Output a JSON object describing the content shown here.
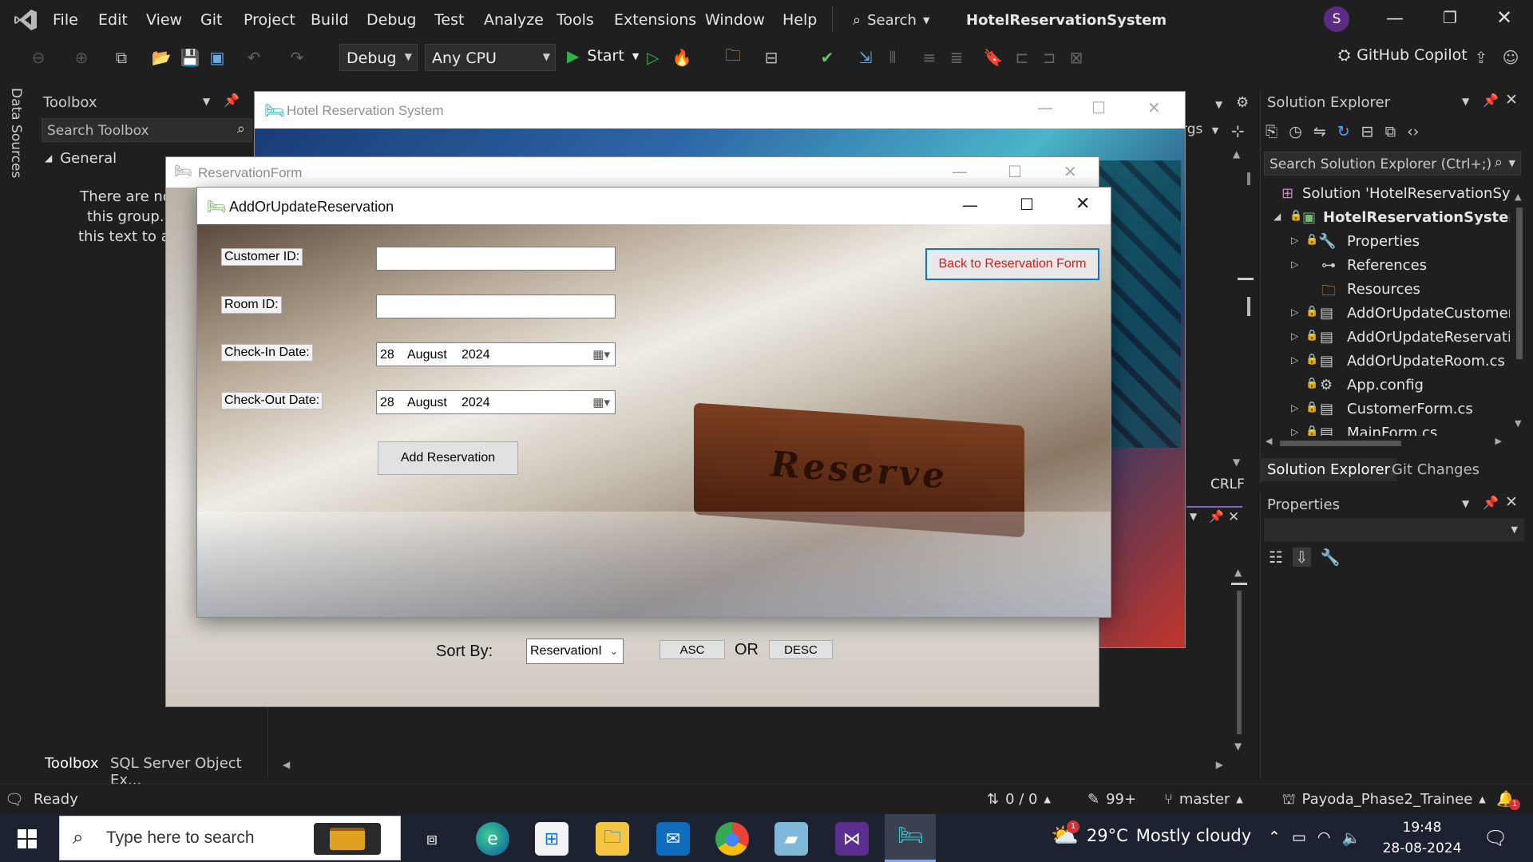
{
  "vs": {
    "menu": [
      "File",
      "Edit",
      "View",
      "Git",
      "Project",
      "Build",
      "Debug",
      "Test",
      "Analyze",
      "Tools",
      "Extensions",
      "Window",
      "Help"
    ],
    "search_label": "Search",
    "solution_title": "HotelReservationSystem",
    "account_initial": "S",
    "config": "Debug",
    "platform": "Any CPU",
    "start_label": "Start",
    "copilot_label": "GitHub Copilot",
    "data_sources": "Data Sources",
    "args_label": "rgs",
    "crlf": "CRLF"
  },
  "toolbox": {
    "title": "Toolbox",
    "search_placeholder": "Search Toolbox",
    "group": "General",
    "empty_line1": "There are no usab",
    "empty_line2": "this group. Drag",
    "empty_line3": "this text to add it t",
    "tab1": "Toolbox",
    "tab2": "SQL Server Object Ex..."
  },
  "solution_explorer": {
    "title": "Solution Explorer",
    "search_placeholder": "Search Solution Explorer (Ctrl+;)",
    "items": [
      {
        "label": "Solution 'HotelReservationSyste"
      },
      {
        "label": "HotelReservationSystem"
      },
      {
        "label": "Properties"
      },
      {
        "label": "References"
      },
      {
        "label": "Resources"
      },
      {
        "label": "AddOrUpdateCustomer.c"
      },
      {
        "label": "AddOrUpdateReservation"
      },
      {
        "label": "AddOrUpdateRoom.cs"
      },
      {
        "label": "App.config"
      },
      {
        "label": "CustomerForm.cs"
      },
      {
        "label": "MainForm.cs"
      }
    ],
    "tab1": "Solution Explorer",
    "tab2": "Git Changes"
  },
  "properties": {
    "title": "Properties"
  },
  "statusbar": {
    "ready": "Ready",
    "arrows": "0 / 0",
    "pencil": "99+",
    "branch": "master",
    "repo": "Payoda_Phase2_Trainee",
    "notifications": "1"
  },
  "taskbar": {
    "search_placeholder": "Type here to search",
    "weather_temp": "29°C",
    "weather_desc": "Mostly cloudy",
    "weather_badge": "1",
    "time": "19:48",
    "date": "28-08-2024"
  },
  "main_window": {
    "title": "Hotel Reservation System"
  },
  "reservation_form": {
    "title": "ReservationForm",
    "sort_by_label": "Sort By:",
    "sort_value": "ReservationI",
    "asc_label": "ASC",
    "or_label": "OR",
    "desc_label": "DESC"
  },
  "add_update_form": {
    "title": "AddOrUpdateReservation",
    "customer_id_label": "Customer ID:",
    "room_id_label": "Room ID:",
    "checkin_label": "Check-In Date:",
    "checkout_label": "Check-Out Date:",
    "checkin": {
      "day": "28",
      "month": "August",
      "year": "2024"
    },
    "checkout": {
      "day": "28",
      "month": "August",
      "year": "2024"
    },
    "customer_id_value": "",
    "room_id_value": "",
    "add_button": "Add Reservation",
    "back_button": "Back to Reservation Form",
    "sign_text": "Reserve"
  },
  "colors": {
    "vs_purple": "#8661c5",
    "back_button_text": "#d31c1c",
    "back_button_border": "#0078d7"
  }
}
